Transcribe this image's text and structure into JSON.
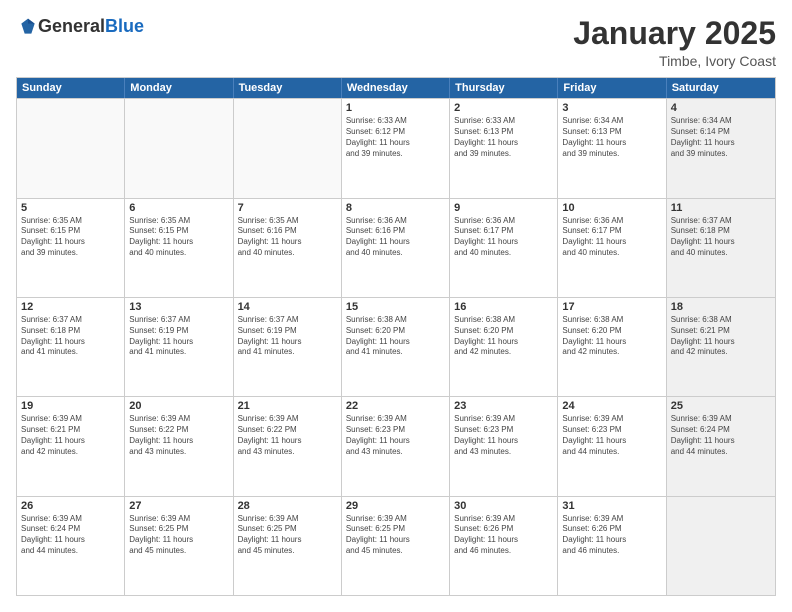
{
  "logo": {
    "general": "General",
    "blue": "Blue"
  },
  "header": {
    "month": "January 2025",
    "location": "Timbe, Ivory Coast"
  },
  "weekdays": [
    "Sunday",
    "Monday",
    "Tuesday",
    "Wednesday",
    "Thursday",
    "Friday",
    "Saturday"
  ],
  "weeks": [
    [
      {
        "day": "",
        "info": "",
        "empty": true
      },
      {
        "day": "",
        "info": "",
        "empty": true
      },
      {
        "day": "",
        "info": "",
        "empty": true
      },
      {
        "day": "1",
        "info": "Sunrise: 6:33 AM\nSunset: 6:12 PM\nDaylight: 11 hours\nand 39 minutes."
      },
      {
        "day": "2",
        "info": "Sunrise: 6:33 AM\nSunset: 6:13 PM\nDaylight: 11 hours\nand 39 minutes."
      },
      {
        "day": "3",
        "info": "Sunrise: 6:34 AM\nSunset: 6:13 PM\nDaylight: 11 hours\nand 39 minutes."
      },
      {
        "day": "4",
        "info": "Sunrise: 6:34 AM\nSunset: 6:14 PM\nDaylight: 11 hours\nand 39 minutes.",
        "shaded": true
      }
    ],
    [
      {
        "day": "5",
        "info": "Sunrise: 6:35 AM\nSunset: 6:15 PM\nDaylight: 11 hours\nand 39 minutes."
      },
      {
        "day": "6",
        "info": "Sunrise: 6:35 AM\nSunset: 6:15 PM\nDaylight: 11 hours\nand 40 minutes."
      },
      {
        "day": "7",
        "info": "Sunrise: 6:35 AM\nSunset: 6:16 PM\nDaylight: 11 hours\nand 40 minutes."
      },
      {
        "day": "8",
        "info": "Sunrise: 6:36 AM\nSunset: 6:16 PM\nDaylight: 11 hours\nand 40 minutes."
      },
      {
        "day": "9",
        "info": "Sunrise: 6:36 AM\nSunset: 6:17 PM\nDaylight: 11 hours\nand 40 minutes."
      },
      {
        "day": "10",
        "info": "Sunrise: 6:36 AM\nSunset: 6:17 PM\nDaylight: 11 hours\nand 40 minutes."
      },
      {
        "day": "11",
        "info": "Sunrise: 6:37 AM\nSunset: 6:18 PM\nDaylight: 11 hours\nand 40 minutes.",
        "shaded": true
      }
    ],
    [
      {
        "day": "12",
        "info": "Sunrise: 6:37 AM\nSunset: 6:18 PM\nDaylight: 11 hours\nand 41 minutes."
      },
      {
        "day": "13",
        "info": "Sunrise: 6:37 AM\nSunset: 6:19 PM\nDaylight: 11 hours\nand 41 minutes."
      },
      {
        "day": "14",
        "info": "Sunrise: 6:37 AM\nSunset: 6:19 PM\nDaylight: 11 hours\nand 41 minutes."
      },
      {
        "day": "15",
        "info": "Sunrise: 6:38 AM\nSunset: 6:20 PM\nDaylight: 11 hours\nand 41 minutes."
      },
      {
        "day": "16",
        "info": "Sunrise: 6:38 AM\nSunset: 6:20 PM\nDaylight: 11 hours\nand 42 minutes."
      },
      {
        "day": "17",
        "info": "Sunrise: 6:38 AM\nSunset: 6:20 PM\nDaylight: 11 hours\nand 42 minutes."
      },
      {
        "day": "18",
        "info": "Sunrise: 6:38 AM\nSunset: 6:21 PM\nDaylight: 11 hours\nand 42 minutes.",
        "shaded": true
      }
    ],
    [
      {
        "day": "19",
        "info": "Sunrise: 6:39 AM\nSunset: 6:21 PM\nDaylight: 11 hours\nand 42 minutes."
      },
      {
        "day": "20",
        "info": "Sunrise: 6:39 AM\nSunset: 6:22 PM\nDaylight: 11 hours\nand 43 minutes."
      },
      {
        "day": "21",
        "info": "Sunrise: 6:39 AM\nSunset: 6:22 PM\nDaylight: 11 hours\nand 43 minutes."
      },
      {
        "day": "22",
        "info": "Sunrise: 6:39 AM\nSunset: 6:23 PM\nDaylight: 11 hours\nand 43 minutes."
      },
      {
        "day": "23",
        "info": "Sunrise: 6:39 AM\nSunset: 6:23 PM\nDaylight: 11 hours\nand 43 minutes."
      },
      {
        "day": "24",
        "info": "Sunrise: 6:39 AM\nSunset: 6:23 PM\nDaylight: 11 hours\nand 44 minutes."
      },
      {
        "day": "25",
        "info": "Sunrise: 6:39 AM\nSunset: 6:24 PM\nDaylight: 11 hours\nand 44 minutes.",
        "shaded": true
      }
    ],
    [
      {
        "day": "26",
        "info": "Sunrise: 6:39 AM\nSunset: 6:24 PM\nDaylight: 11 hours\nand 44 minutes."
      },
      {
        "day": "27",
        "info": "Sunrise: 6:39 AM\nSunset: 6:25 PM\nDaylight: 11 hours\nand 45 minutes."
      },
      {
        "day": "28",
        "info": "Sunrise: 6:39 AM\nSunset: 6:25 PM\nDaylight: 11 hours\nand 45 minutes."
      },
      {
        "day": "29",
        "info": "Sunrise: 6:39 AM\nSunset: 6:25 PM\nDaylight: 11 hours\nand 45 minutes."
      },
      {
        "day": "30",
        "info": "Sunrise: 6:39 AM\nSunset: 6:26 PM\nDaylight: 11 hours\nand 46 minutes."
      },
      {
        "day": "31",
        "info": "Sunrise: 6:39 AM\nSunset: 6:26 PM\nDaylight: 11 hours\nand 46 minutes."
      },
      {
        "day": "",
        "info": "",
        "empty": true,
        "shaded": true
      }
    ]
  ]
}
